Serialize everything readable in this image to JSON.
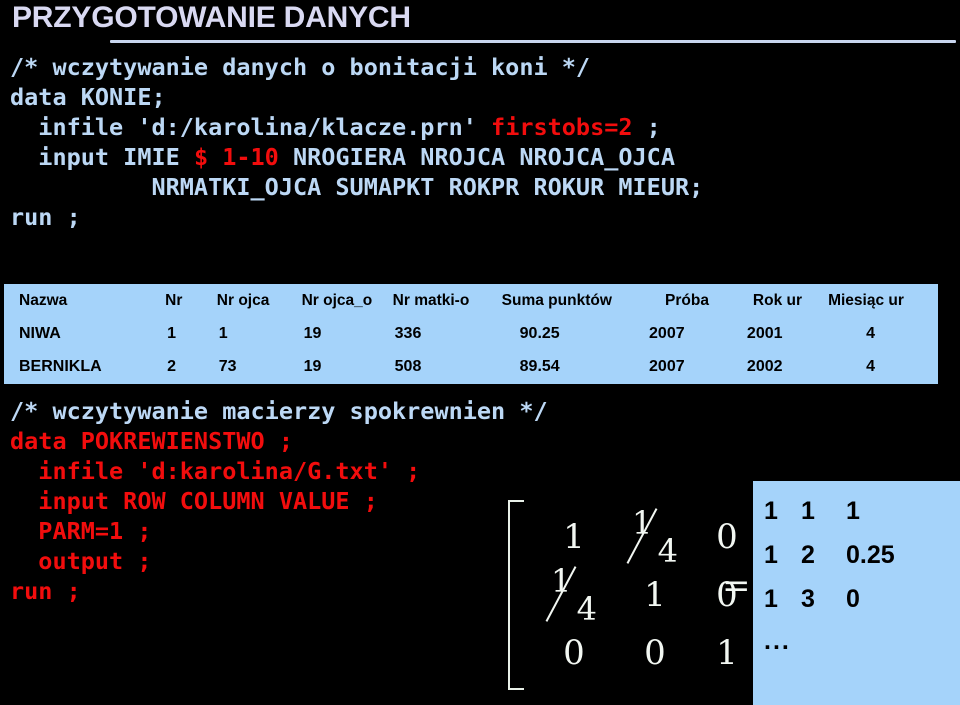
{
  "slide": {
    "title": "PRZYGOTOWANIE DANYCH"
  },
  "code_top": {
    "lines": [
      [
        {
          "t": "/* wczytywanie danych o bonitacji koni */",
          "c": "blue"
        }
      ],
      [
        {
          "t": "data KONIE;",
          "c": "blue"
        }
      ],
      [
        {
          "t": "  infile 'd:/karolina/klacze.prn' ",
          "c": "blue"
        },
        {
          "t": "firstobs=2",
          "c": "red"
        },
        {
          "t": " ;",
          "c": "blue"
        }
      ],
      [
        {
          "t": "  input IMIE ",
          "c": "blue"
        },
        {
          "t": "$ 1-10",
          "c": "red"
        },
        {
          "t": " NROGIERA NROJCA NROJCA_OJCA",
          "c": "blue"
        }
      ],
      [
        {
          "t": "          NRMATKI_OJCA SUMAPKT ROKPR ROKUR MIEUR;",
          "c": "blue"
        }
      ],
      [
        {
          "t": "run ;",
          "c": "blue"
        }
      ]
    ]
  },
  "data_table": {
    "headers": [
      "Nazwa",
      "Nr",
      "Nr ojca",
      "Nr ojca_o",
      "Nr matki-o",
      "Suma punktów",
      "Próba",
      "Rok ur",
      "Miesiąc ur"
    ],
    "rows": [
      [
        "NIWA",
        "1",
        "1",
        "19",
        "336",
        "90.25",
        "2007",
        "2001",
        "4"
      ],
      [
        "BERNIKLA",
        "2",
        "73",
        "19",
        "508",
        "89.54",
        "2007",
        "2002",
        "4"
      ]
    ]
  },
  "code_bottom": {
    "lines": [
      [
        {
          "t": "/* wczytywanie macierzy spokrewnien */",
          "c": "blue"
        }
      ],
      [
        {
          "t": "data POKREWIENSTWO ;",
          "c": "red"
        }
      ],
      [
        {
          "t": "  infile 'd:karolina/G.txt' ;",
          "c": "red"
        }
      ],
      [
        {
          "t": "  input ROW COLUMN VALUE ;",
          "c": "red"
        }
      ],
      [
        {
          "t": "  PARM=1 ;",
          "c": "red"
        }
      ],
      [
        {
          "t": "  output ;",
          "c": "red"
        }
      ],
      [
        {
          "t": "run ;",
          "c": "red"
        }
      ]
    ]
  },
  "matrix": {
    "rows": [
      [
        {
          "v": "1"
        },
        {
          "num": "1",
          "den": "4"
        },
        {
          "v": "0"
        }
      ],
      [
        {
          "num": "1",
          "den": "4"
        },
        {
          "v": "1"
        },
        {
          "v": "0"
        }
      ],
      [
        {
          "v": "0"
        },
        {
          "v": "0"
        },
        {
          "v": "1"
        }
      ]
    ],
    "equals": "="
  },
  "value_table": {
    "rows": [
      [
        "1",
        "1",
        "1"
      ],
      [
        "1",
        "2",
        "0.25"
      ],
      [
        "1",
        "3",
        "0"
      ]
    ],
    "ellipsis": "..."
  },
  "colors": {
    "background": "#000000",
    "title": "#d9d9f2",
    "code_blue": "#bcd8f5",
    "code_red": "#f20d0d",
    "table_bg": "#a5d3fa",
    "table_text": "#000000",
    "matrix": "#f2f7f2"
  }
}
